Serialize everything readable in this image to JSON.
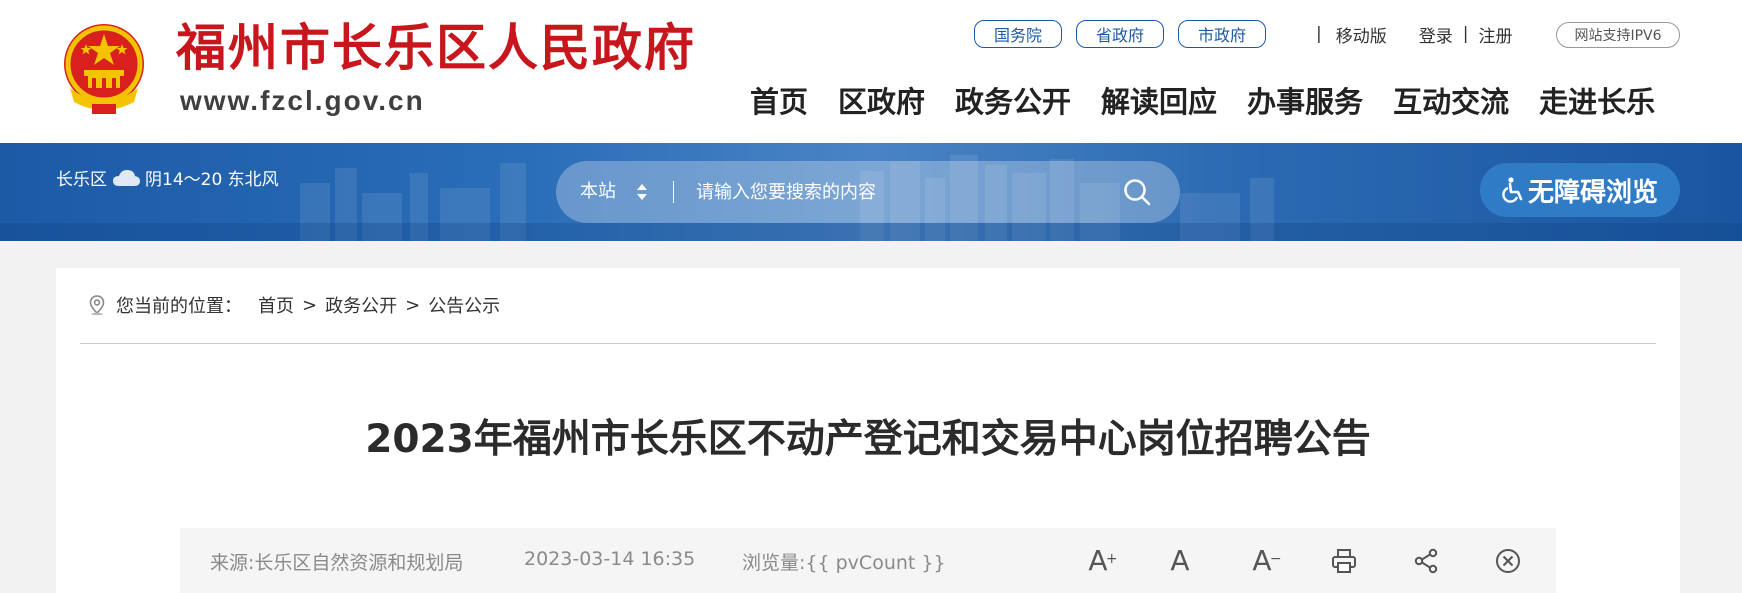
{
  "header": {
    "site_title": "福州市长乐区人民政府",
    "site_url": "www.fzcl.gov.cn",
    "top_links": [
      "国务院",
      "省政府",
      "市政府"
    ],
    "separator": "|",
    "mobile": "移动版",
    "login": "登录",
    "login_sep": "|",
    "register": "注册",
    "ipv6": "网站支持IPV6",
    "nav": [
      "首页",
      "区政府",
      "政务公开",
      "解读回应",
      "办事服务",
      "互动交流",
      "走进长乐"
    ]
  },
  "banner": {
    "weather_location": "长乐区",
    "weather_icon": "cloud-icon",
    "weather_text": "阴14～20 东北风",
    "search_scope": "本站",
    "search_placeholder": "请输入您要搜索的内容",
    "accessibility_label": "无障碍浏览"
  },
  "breadcrumb": {
    "label": "您当前的位置：",
    "items": [
      "首页",
      "政务公开",
      "公告公示"
    ],
    "sep": ">"
  },
  "article": {
    "title": "2023年福州市长乐区不动产登记和交易中心岗位招聘公告",
    "source": "来源:长乐区自然资源和规划局",
    "date": "2023-03-14 16:35",
    "views": "浏览量:{{ pvCount }}",
    "font_large": "A",
    "font_large_sup": "+",
    "font_normal": "A",
    "font_small": "A",
    "font_small_sup": "−"
  },
  "colors": {
    "title_red": "#c8161d",
    "link_blue": "#1d5aa5",
    "banner_blue": "#1c5aa6"
  }
}
